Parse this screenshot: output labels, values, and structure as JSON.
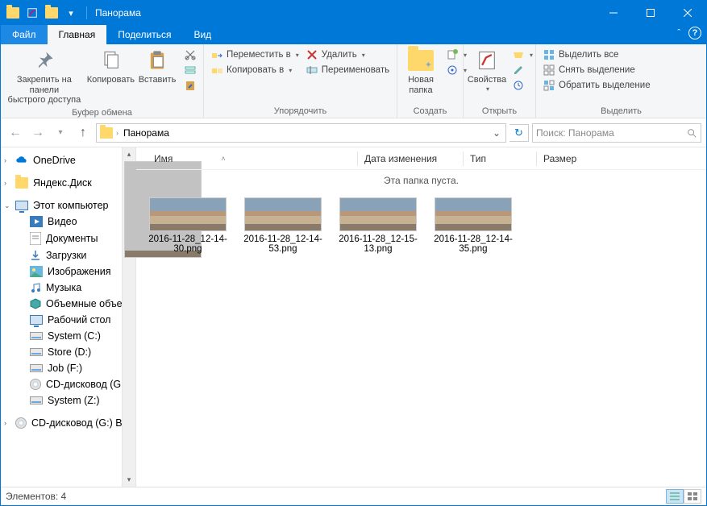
{
  "window": {
    "title": "Панорама"
  },
  "tabbar": {
    "file": "Файл",
    "tabs": [
      "Главная",
      "Поделиться",
      "Вид"
    ],
    "active_index": 0
  },
  "ribbon": {
    "groups": {
      "clipboard": {
        "label": "Буфер обмена",
        "pin": "Закрепить на панели\nбыстрого доступа",
        "copy": "Копировать",
        "paste": "Вставить"
      },
      "organize": {
        "label": "Упорядочить",
        "move_to": "Переместить в",
        "copy_to": "Копировать в",
        "delete": "Удалить",
        "rename": "Переименовать"
      },
      "new": {
        "label": "Создать",
        "new_folder": "Новая\nпапка"
      },
      "open": {
        "label": "Открыть",
        "properties": "Свойства"
      },
      "select": {
        "label": "Выделить",
        "select_all": "Выделить все",
        "select_none": "Снять выделение",
        "invert": "Обратить выделение"
      }
    }
  },
  "address": {
    "crumb": "Панорама"
  },
  "search": {
    "placeholder": "Поиск: Панорама"
  },
  "columns": {
    "name": "Имя",
    "date": "Дата изменения",
    "type": "Тип",
    "size": "Размер"
  },
  "empty_message": "Эта папка пуста.",
  "nav": {
    "onedrive": "OneDrive",
    "yadisk": "Яндекс.Диск",
    "this_pc": "Этот компьютер",
    "videos": "Видео",
    "documents": "Документы",
    "downloads": "Загрузки",
    "pictures": "Изображения",
    "music": "Музыка",
    "volumes": "Объемные объек",
    "desktop": "Рабочий стол",
    "system_c": "System (C:)",
    "store_d": "Store (D:)",
    "job_f": "Job (F:)",
    "cd_g": "CD-дисковод (G:)",
    "system_z": "System (Z:)",
    "cd_g2": "CD-дисковод (G:) B"
  },
  "files": [
    {
      "name": "2016-11-28_12-14-30.png"
    },
    {
      "name": "2016-11-28_12-14-53.png"
    },
    {
      "name": "2016-11-28_12-15-13.png"
    },
    {
      "name": "2016-11-28_12-14-35.png"
    }
  ],
  "status": {
    "items_label": "Элементов:",
    "items_count": "4"
  }
}
